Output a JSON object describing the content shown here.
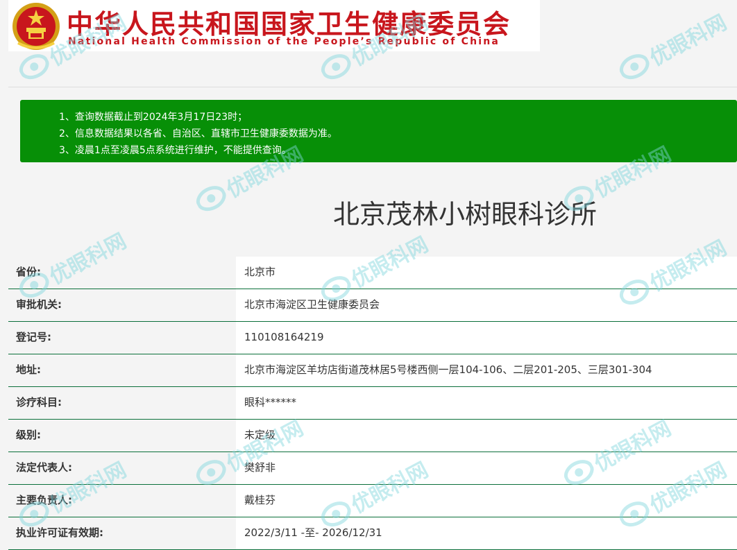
{
  "header": {
    "title_cn": "中华人民共和国国家卫生健康委员会",
    "title_en": "National Health Commission of the People’s Republic of China"
  },
  "notice": {
    "lines": [
      "1、查询数据截止到2024年3月17日23时；",
      "2、信息数据结果以各省、自治区、直辖市卫生健康委数据为准。",
      "3、凌晨1点至凌晨5点系统进行维护，不能提供查询。"
    ],
    "background_color": "#078f07"
  },
  "clinic": {
    "name": "北京茂林小树眼科诊所"
  },
  "rows": [
    {
      "label": "省份:",
      "value": "北京市"
    },
    {
      "label": "审批机关:",
      "value": "北京市海淀区卫生健康委员会"
    },
    {
      "label": "登记号:",
      "value": "110108164219"
    },
    {
      "label": "地址:",
      "value": "北京市海淀区羊坊店街道茂林居5号楼西侧一层104-106、二层201-205、三层301-304"
    },
    {
      "label": "诊疗科目:",
      "value": "眼科******"
    },
    {
      "label": "级别:",
      "value": "未定级"
    },
    {
      "label": "法定代表人:",
      "value": "樊舒非"
    },
    {
      "label": "主要负责人:",
      "value": "戴桂芬"
    },
    {
      "label": "执业许可证有效期:",
      "value": "2022/3/11 -至- 2026/12/31"
    }
  ],
  "watermark": {
    "text": "优眼科网",
    "color": "#7fd6dd"
  },
  "colors": {
    "header_red": "#c8161d",
    "row_divider": "#0a6f3a"
  },
  "icons": {
    "emblem": "national-emblem-icon",
    "watermark_logo": "eye-logo-icon"
  }
}
